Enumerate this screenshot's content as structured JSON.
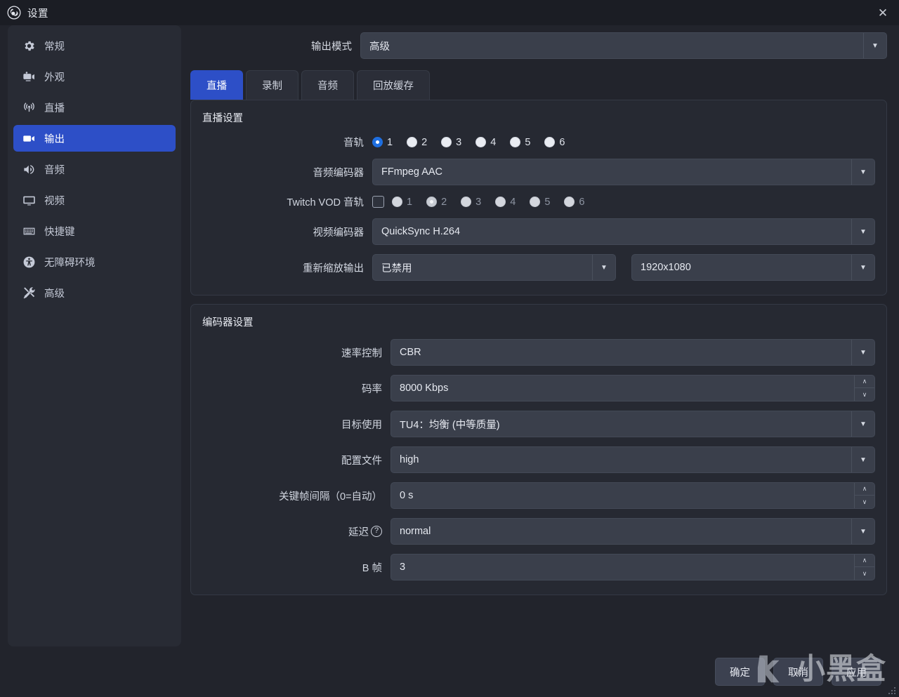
{
  "window": {
    "title": "设置",
    "logo_icon": "obs-logo-icon",
    "close_icon": "close-icon"
  },
  "sidebar": {
    "items": [
      {
        "label": "常规",
        "icon": "gear-icon",
        "active": false
      },
      {
        "label": "外观",
        "icon": "appearance-icon",
        "active": false
      },
      {
        "label": "直播",
        "icon": "broadcast-icon",
        "active": false
      },
      {
        "label": "输出",
        "icon": "output-camera-icon",
        "active": true
      },
      {
        "label": "音频",
        "icon": "speaker-icon",
        "active": false
      },
      {
        "label": "视频",
        "icon": "monitor-icon",
        "active": false
      },
      {
        "label": "快捷键",
        "icon": "keyboard-icon",
        "active": false
      },
      {
        "label": "无障碍环境",
        "icon": "accessibility-icon",
        "active": false
      },
      {
        "label": "高级",
        "icon": "tools-icon",
        "active": false
      }
    ]
  },
  "output_mode": {
    "label": "输出模式",
    "value": "高级",
    "dropdown_icon": "chevron-down-icon"
  },
  "tabs": [
    {
      "label": "直播",
      "active": true
    },
    {
      "label": "录制",
      "active": false
    },
    {
      "label": "音频",
      "active": false
    },
    {
      "label": "回放缓存",
      "active": false
    }
  ],
  "stream_panel": {
    "title": "直播设置",
    "audio_track": {
      "label": "音轨",
      "options": [
        "1",
        "2",
        "3",
        "4",
        "5",
        "6"
      ],
      "selected": "1"
    },
    "audio_encoder": {
      "label": "音频编码器",
      "value": "FFmpeg AAC"
    },
    "twitch_vod": {
      "label": "Twitch VOD 音轨",
      "checkbox_checked": false,
      "options": [
        "1",
        "2",
        "3",
        "4",
        "5",
        "6"
      ],
      "selected": "2",
      "disabled": true
    },
    "video_encoder": {
      "label": "视频编码器",
      "value": "QuickSync H.264"
    },
    "rescale_output": {
      "label": "重新缩放输出",
      "value": "已禁用",
      "resolution": "1920x1080"
    }
  },
  "encoder_panel": {
    "title": "编码器设置",
    "rows": [
      {
        "label": "速率控制",
        "value": "CBR",
        "type": "combo"
      },
      {
        "label": "码率",
        "value": "8000 Kbps",
        "type": "spin"
      },
      {
        "label": "目标使用",
        "value": "TU4：均衡 (中等质量)",
        "type": "combo"
      },
      {
        "label": "配置文件",
        "value": "high",
        "type": "combo"
      },
      {
        "label": "关键帧间隔（0=自动）",
        "value": "0 s",
        "type": "spin"
      },
      {
        "label": "延迟",
        "value": "normal",
        "type": "combo",
        "help": true
      },
      {
        "label": "B 帧",
        "value": "3",
        "type": "spin"
      }
    ]
  },
  "footer": {
    "buttons": [
      {
        "label": "确定"
      },
      {
        "label": "取消"
      },
      {
        "label": "应用"
      }
    ]
  },
  "watermark": {
    "text": "小黑盒",
    "logo_icon": "heybox-logo-icon"
  },
  "colors": {
    "accent_blue": "#2d4fc7",
    "radio_blue": "#1f6fe0",
    "window_bg": "#22242c",
    "titlebar_bg": "#1b1d24",
    "sidebar_bg": "#282b34",
    "panel_bg": "#262932",
    "field_bg": "#3a3f4b"
  }
}
